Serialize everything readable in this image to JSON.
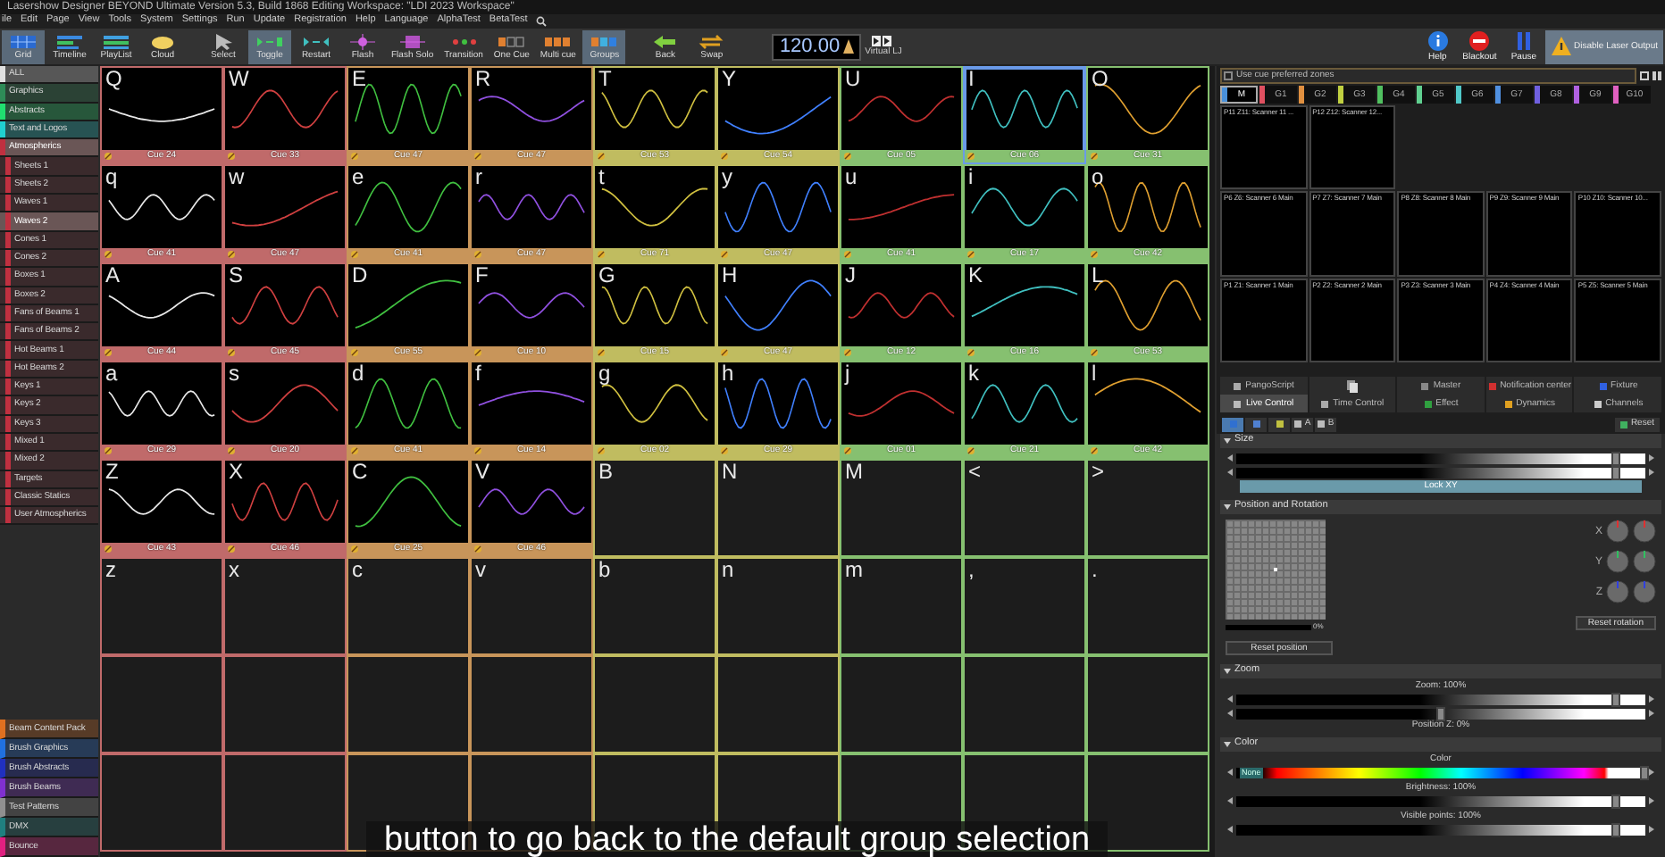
{
  "window": {
    "title": "Lasershow Designer BEYOND Ultimate   Version 5.3, Build 1868   Editing Workspace: \"LDI 2023 Workspace\""
  },
  "menu": [
    "ile",
    "Edit",
    "Page",
    "View",
    "Tools",
    "System",
    "Settings",
    "Run",
    "Update",
    "Registration",
    "Help",
    "Language",
    "AlphaTest",
    "BetaTest"
  ],
  "toolbar": [
    {
      "label": "Grid",
      "selected": true
    },
    {
      "label": "Timeline",
      "selected": false
    },
    {
      "label": "PlayList",
      "selected": false
    },
    {
      "label": "Cloud",
      "selected": false
    },
    {
      "label": "Select",
      "selected": false
    },
    {
      "label": "Toggle",
      "selected": true
    },
    {
      "label": "Restart",
      "selected": false
    },
    {
      "label": "Flash",
      "selected": false
    },
    {
      "label": "Flash Solo",
      "selected": false
    },
    {
      "label": "Transition",
      "selected": false
    },
    {
      "label": "One Cue",
      "selected": false
    },
    {
      "label": "Multi cue",
      "selected": false
    },
    {
      "label": "Groups",
      "selected": true
    },
    {
      "label": "Back",
      "selected": false
    },
    {
      "label": "Swap",
      "selected": false
    }
  ],
  "bpm": "120.00",
  "virtual_lj": "Virtual LJ",
  "toolbar_right": [
    {
      "label": "Help",
      "selected": false
    },
    {
      "label": "Blackout",
      "selected": false
    },
    {
      "label": "Pause",
      "selected": false
    },
    {
      "label": "Disable Laser Output",
      "selected": true
    }
  ],
  "sidebar": {
    "items": [
      {
        "label": "ALL",
        "color": "#e0e0e0",
        "selected": false
      },
      {
        "label": "Graphics",
        "color": "#2e8b57",
        "selected": false
      },
      {
        "label": "Abstracts",
        "color": "#20e070",
        "selected": false
      },
      {
        "label": "Text and Logos",
        "color": "#20d0d0",
        "selected": false
      },
      {
        "label": "Atmospherics",
        "color": "#c03040",
        "selected": true,
        "expanded": true,
        "children": [
          {
            "label": "Sheets 1",
            "selected": false
          },
          {
            "label": "Sheets 2",
            "selected": false
          },
          {
            "label": "Waves 1",
            "selected": false
          },
          {
            "label": "Waves 2",
            "selected": true
          },
          {
            "label": "Cones 1",
            "selected": false
          },
          {
            "label": "Cones 2",
            "selected": false
          },
          {
            "label": "Boxes 1",
            "selected": false
          },
          {
            "label": "Boxes 2",
            "selected": false
          },
          {
            "label": "Fans of Beams 1",
            "selected": false
          },
          {
            "label": "Fans of Beams 2",
            "selected": false
          },
          {
            "label": "Hot Beams 1",
            "selected": false
          },
          {
            "label": "Hot Beams 2",
            "selected": false
          },
          {
            "label": "Keys 1",
            "selected": false
          },
          {
            "label": "Keys 2",
            "selected": false
          },
          {
            "label": "Keys 3",
            "selected": false
          },
          {
            "label": "Mixed 1",
            "selected": false
          },
          {
            "label": "Mixed 2",
            "selected": false
          },
          {
            "label": "Targets",
            "selected": false
          },
          {
            "label": "Classic Statics",
            "selected": false
          },
          {
            "label": "User Atmospherics",
            "selected": false
          }
        ]
      }
    ],
    "bottom_items": [
      {
        "label": "Beam Content Pack",
        "color": "#e07020",
        "selected": false
      },
      {
        "label": "Brush Graphics",
        "color": "#2070e0",
        "selected": false
      },
      {
        "label": "Brush Abstracts",
        "color": "#2030c0",
        "selected": false
      },
      {
        "label": "Brush Beams",
        "color": "#8030d0",
        "selected": false
      },
      {
        "label": "Test Patterns",
        "color": "#909090",
        "selected": false
      },
      {
        "label": "DMX",
        "color": "#208080",
        "selected": false
      },
      {
        "label": "Bounce",
        "color": "#e02080",
        "selected": false
      }
    ]
  },
  "grid": {
    "rows": [
      {
        "cells": [
          {
            "key": "Q",
            "kind": "cue",
            "cue": "Cue 24",
            "color": "#c06a6a",
            "selected": false
          },
          {
            "key": "W",
            "kind": "cue",
            "cue": "Cue 33",
            "color": "#c06a6a",
            "selected": false
          },
          {
            "key": "E",
            "kind": "cue",
            "cue": "Cue 47",
            "color": "#c8955a",
            "selected": false
          },
          {
            "key": "R",
            "kind": "cue",
            "cue": "Cue 47",
            "color": "#c8955a",
            "selected": false
          },
          {
            "key": "T",
            "kind": "cue",
            "cue": "Cue 53",
            "color": "#c0bc60",
            "selected": false
          },
          {
            "key": "Y",
            "kind": "cue",
            "cue": "Cue 54",
            "color": "#c0bc60",
            "selected": false
          },
          {
            "key": "U",
            "kind": "cue",
            "cue": "Cue 05",
            "color": "#86c070",
            "selected": false
          },
          {
            "key": "I",
            "kind": "cue",
            "cue": "Cue 06",
            "color": "#86c070",
            "selected": true
          },
          {
            "key": "O",
            "kind": "cue",
            "cue": "Cue 31",
            "color": "#86c070",
            "selected": false
          }
        ]
      },
      {
        "cells": [
          {
            "key": "q",
            "kind": "cue",
            "cue": "Cue 41",
            "color": "#c06a6a",
            "selected": false
          },
          {
            "key": "w",
            "kind": "cue",
            "cue": "Cue 47",
            "color": "#c06a6a",
            "selected": false
          },
          {
            "key": "e",
            "kind": "cue",
            "cue": "Cue 41",
            "color": "#c8955a",
            "selected": false
          },
          {
            "key": "r",
            "kind": "cue",
            "cue": "Cue 47",
            "color": "#c8955a",
            "selected": false
          },
          {
            "key": "t",
            "kind": "cue",
            "cue": "Cue 71",
            "color": "#c0bc60",
            "selected": false
          },
          {
            "key": "y",
            "kind": "cue",
            "cue": "Cue 47",
            "color": "#c0bc60",
            "selected": false
          },
          {
            "key": "u",
            "kind": "cue",
            "cue": "Cue 41",
            "color": "#86c070",
            "selected": false
          },
          {
            "key": "i",
            "kind": "cue",
            "cue": "Cue 17",
            "color": "#86c070",
            "selected": false
          },
          {
            "key": "o",
            "kind": "cue",
            "cue": "Cue 42",
            "color": "#86c070",
            "selected": false
          }
        ]
      },
      {
        "cells": [
          {
            "key": "A",
            "kind": "cue",
            "cue": "Cue 44",
            "color": "#c06a6a",
            "selected": false
          },
          {
            "key": "S",
            "kind": "cue",
            "cue": "Cue 45",
            "color": "#c06a6a",
            "selected": false
          },
          {
            "key": "D",
            "kind": "cue",
            "cue": "Cue 55",
            "color": "#c8955a",
            "selected": false
          },
          {
            "key": "F",
            "kind": "cue",
            "cue": "Cue 10",
            "color": "#c8955a",
            "selected": false
          },
          {
            "key": "G",
            "kind": "cue",
            "cue": "Cue 15",
            "color": "#c0bc60",
            "selected": false
          },
          {
            "key": "H",
            "kind": "cue",
            "cue": "Cue 47",
            "color": "#c0bc60",
            "selected": false
          },
          {
            "key": "J",
            "kind": "cue",
            "cue": "Cue 12",
            "color": "#86c070",
            "selected": false
          },
          {
            "key": "K",
            "kind": "cue",
            "cue": "Cue 16",
            "color": "#86c070",
            "selected": false
          },
          {
            "key": "L",
            "kind": "cue",
            "cue": "Cue 53",
            "color": "#86c070",
            "selected": false
          }
        ]
      },
      {
        "cells": [
          {
            "key": "a",
            "kind": "cue",
            "cue": "Cue 29",
            "color": "#c06a6a",
            "selected": false
          },
          {
            "key": "s",
            "kind": "cue",
            "cue": "Cue 20",
            "color": "#c06a6a",
            "selected": false
          },
          {
            "key": "d",
            "kind": "cue",
            "cue": "Cue 41",
            "color": "#c8955a",
            "selected": false
          },
          {
            "key": "f",
            "kind": "cue",
            "cue": "Cue 14",
            "color": "#c8955a",
            "selected": false
          },
          {
            "key": "g",
            "kind": "cue",
            "cue": "Cue 02",
            "color": "#c0bc60",
            "selected": false
          },
          {
            "key": "h",
            "kind": "cue",
            "cue": "Cue 29",
            "color": "#c0bc60",
            "selected": false
          },
          {
            "key": "j",
            "kind": "cue",
            "cue": "Cue 01",
            "color": "#86c070",
            "selected": false
          },
          {
            "key": "k",
            "kind": "cue",
            "cue": "Cue 21",
            "color": "#86c070",
            "selected": false
          },
          {
            "key": "l",
            "kind": "cue",
            "cue": "Cue 42",
            "color": "#86c070",
            "selected": false
          }
        ]
      },
      {
        "cells": [
          {
            "key": "Z",
            "kind": "cue",
            "cue": "Cue 43",
            "color": "#c06a6a",
            "selected": false
          },
          {
            "key": "X",
            "kind": "cue",
            "cue": "Cue 46",
            "color": "#c06a6a",
            "selected": false
          },
          {
            "key": "C",
            "kind": "cue",
            "cue": "Cue 25",
            "color": "#c8955a",
            "selected": false
          },
          {
            "key": "V",
            "kind": "cue",
            "cue": "Cue 46",
            "color": "#c8955a",
            "selected": false
          },
          {
            "key": "B",
            "kind": "empty",
            "selected": false
          },
          {
            "key": "N",
            "kind": "empty",
            "selected": false
          },
          {
            "key": "M",
            "kind": "empty",
            "selected": false
          },
          {
            "key": "<",
            "kind": "empty",
            "selected": false
          },
          {
            "key": ">",
            "kind": "empty",
            "selected": false
          }
        ]
      },
      {
        "cells": [
          {
            "key": "z",
            "kind": "empty",
            "selected": false
          },
          {
            "key": "x",
            "kind": "empty",
            "selected": false
          },
          {
            "key": "c",
            "kind": "empty",
            "selected": false
          },
          {
            "key": "v",
            "kind": "empty",
            "selected": false
          },
          {
            "key": "b",
            "kind": "empty",
            "selected": false
          },
          {
            "key": "n",
            "kind": "empty",
            "selected": false
          },
          {
            "key": "m",
            "kind": "empty",
            "selected": false
          },
          {
            "key": ",",
            "kind": "empty",
            "selected": false
          },
          {
            "key": ".",
            "kind": "empty",
            "selected": false
          }
        ]
      },
      {
        "cells": [
          {
            "kind": "blank"
          },
          {
            "kind": "blank"
          },
          {
            "kind": "blank"
          },
          {
            "kind": "blank"
          },
          {
            "kind": "blank"
          },
          {
            "kind": "blank"
          },
          {
            "kind": "blank"
          },
          {
            "kind": "blank"
          },
          {
            "kind": "blank"
          }
        ]
      },
      {
        "cells": [
          {
            "kind": "blank"
          },
          {
            "kind": "blank"
          },
          {
            "kind": "blank"
          },
          {
            "kind": "blank"
          },
          {
            "kind": "blank"
          },
          {
            "kind": "blank"
          },
          {
            "kind": "blank"
          },
          {
            "kind": "blank"
          },
          {
            "kind": "blank"
          }
        ]
      }
    ]
  },
  "zones": {
    "checkbox": {
      "label": "Use cue preferred zones",
      "checked": false
    },
    "tabs": [
      {
        "label": "M",
        "color": "#4a90d9",
        "selected": true
      },
      {
        "label": "G1",
        "color": "#e05060",
        "selected": false
      },
      {
        "label": "G2",
        "color": "#e09040",
        "selected": false
      },
      {
        "label": "G3",
        "color": "#c0d040",
        "selected": false
      },
      {
        "label": "G4",
        "color": "#50c060",
        "selected": false
      },
      {
        "label": "G5",
        "color": "#60d090",
        "selected": false
      },
      {
        "label": "G6",
        "color": "#50c8c8",
        "selected": false
      },
      {
        "label": "G7",
        "color": "#5090e0",
        "selected": false
      },
      {
        "label": "G8",
        "color": "#7060e0",
        "selected": false
      },
      {
        "label": "G9",
        "color": "#b060e0",
        "selected": false
      },
      {
        "label": "G10",
        "color": "#e060c0",
        "selected": false
      }
    ],
    "rows": [
      [
        "P11 Z11: Scanner 11 ...",
        "P12 Z12: Scanner 12..."
      ],
      [
        "P6 Z6: Scanner 6 Main",
        "P7 Z7: Scanner 7 Main",
        "P8 Z8: Scanner 8 Main",
        "P9 Z9: Scanner 9 Main",
        "P10 Z10: Scanner 10..."
      ],
      [
        "P1 Z1: Scanner 1 Main",
        "P2 Z2: Scanner 2 Main",
        "P3 Z3: Scanner 3 Main",
        "P4 Z4: Scanner 4 Main",
        "P5 Z5: Scanner 5 Main"
      ]
    ]
  },
  "panel_tabs": [
    [
      {
        "kind": "text",
        "label": "PangoScript",
        "selected": false
      },
      {
        "kind": "icon",
        "selected": false
      },
      {
        "kind": "text",
        "label": "Master",
        "selected": false
      },
      {
        "kind": "text",
        "label": "Notification center",
        "selected": false
      },
      {
        "kind": "text",
        "label": "Fixture",
        "selected": false
      }
    ],
    [
      {
        "kind": "text",
        "label": "Live Control",
        "selected": true
      },
      {
        "kind": "text",
        "label": "Time Control",
        "selected": false
      },
      {
        "kind": "text",
        "label": "Effect",
        "selected": false
      },
      {
        "kind": "text",
        "label": "Dynamics",
        "selected": false
      },
      {
        "kind": "text",
        "label": "Channels",
        "selected": false
      }
    ]
  ],
  "mini_tools": [
    {
      "selected": true
    },
    {
      "selected": false
    },
    {
      "selected": false
    },
    {
      "label": "A",
      "selected": false
    },
    {
      "label": "B",
      "selected": false
    }
  ],
  "reset": "Reset",
  "sections": [
    {
      "kind": "size",
      "title": "Size",
      "expanded": true,
      "sliders": [
        {
          "level": 0.93
        },
        {
          "level": 0.93
        }
      ],
      "button": "Lock XY"
    },
    {
      "kind": "position",
      "title": "Position and Rotation",
      "expanded": true,
      "pad_reading": "0%",
      "reset_position": "Reset position",
      "reset_rotation": "Reset rotation",
      "axes": [
        "X",
        "Y",
        "Z"
      ]
    },
    {
      "kind": "zoom",
      "title": "Zoom",
      "expanded": true,
      "sliders": [
        {
          "caption": "Zoom: 100%",
          "level": 0.93
        },
        {
          "caption": "Position Z: 0%",
          "level": 0.5
        }
      ]
    },
    {
      "kind": "color",
      "title": "Color",
      "expanded": true,
      "caption": "Color",
      "none": "None",
      "sliders": [
        {
          "caption": "Brightness: 100%",
          "level": 0.93
        },
        {
          "caption": "Visible points: 100%",
          "level": 0.93
        }
      ]
    }
  ],
  "caption": "button to go back to the default group selection"
}
